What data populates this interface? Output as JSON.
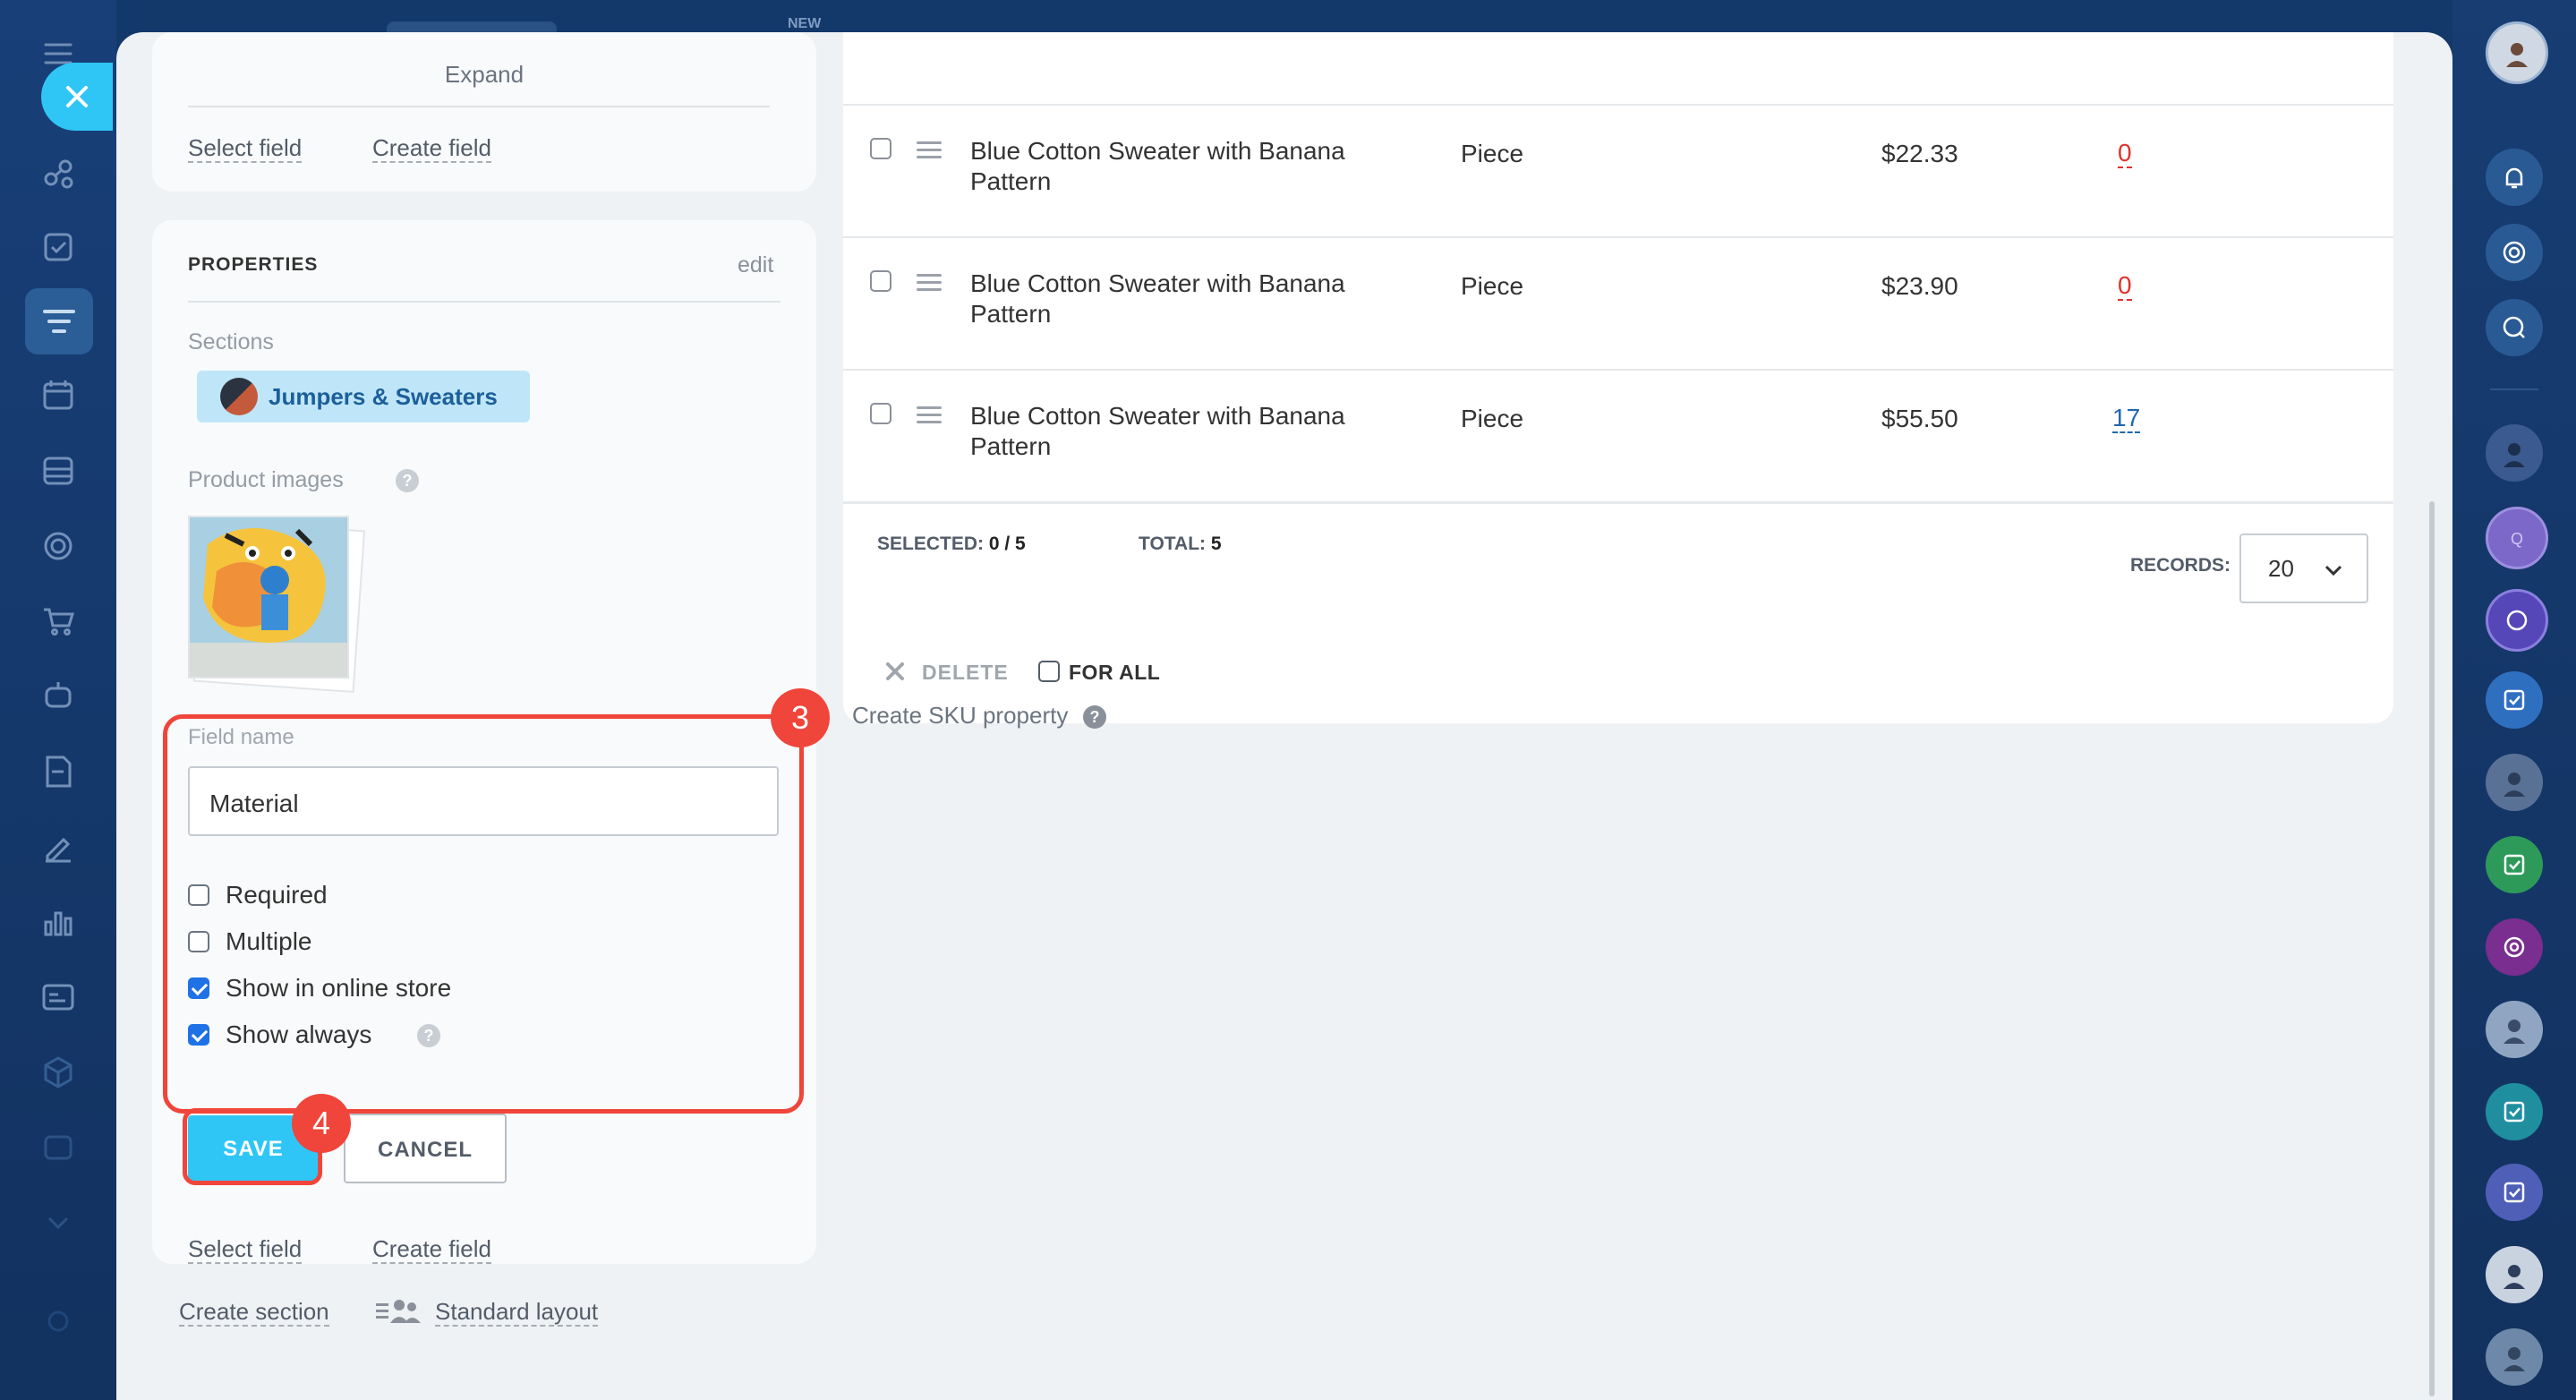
{
  "top": {
    "new_label": "NEW"
  },
  "left_panel": {
    "expand_label": "Expand",
    "select_field": "Select field",
    "create_field": "Create field",
    "properties": {
      "title": "PROPERTIES",
      "edit_label": "edit",
      "sections_label": "Sections",
      "section_tag": "Jumpers & Sweaters",
      "product_images_label": "Product images"
    },
    "field_editor": {
      "field_name_label": "Field name",
      "field_name_value": "Material",
      "options": [
        {
          "label": "Required",
          "checked": false
        },
        {
          "label": "Multiple",
          "checked": false
        },
        {
          "label": "Show in online store",
          "checked": true
        },
        {
          "label": "Show always",
          "checked": true
        }
      ],
      "save_label": "SAVE",
      "cancel_label": "CANCEL"
    },
    "bottom_select_field": "Select field",
    "bottom_create_field": "Create field",
    "create_section": "Create section",
    "standard_layout": "Standard layout"
  },
  "step_badges": {
    "three": "3",
    "four": "4"
  },
  "sku_table": {
    "rows": [
      {
        "title": "Blue Cotton Sweater with Banana Pattern",
        "unit": "Piece",
        "price": "$22.33",
        "qty": "0",
        "qty_color": "#e0322b"
      },
      {
        "title": "Blue Cotton Sweater with Banana Pattern",
        "unit": "Piece",
        "price": "$23.90",
        "qty": "0",
        "qty_color": "#e0322b"
      },
      {
        "title": "Blue Cotton Sweater with Banana Pattern",
        "unit": "Piece",
        "price": "$55.50",
        "qty": "17",
        "qty_color": "#2067b0"
      }
    ],
    "selected_label": "SELECTED:",
    "selected_value": "0 / 5",
    "total_label": "TOTAL:",
    "total_value": "5",
    "records_label": "RECORDS:",
    "records_value": "20",
    "delete_label": "DELETE",
    "for_all_label": "FOR ALL"
  },
  "create_sku_property": "Create SKU property",
  "colors": {
    "accent": "#2fc6f6",
    "highlight": "#f0453a",
    "link": "#2067b0"
  }
}
